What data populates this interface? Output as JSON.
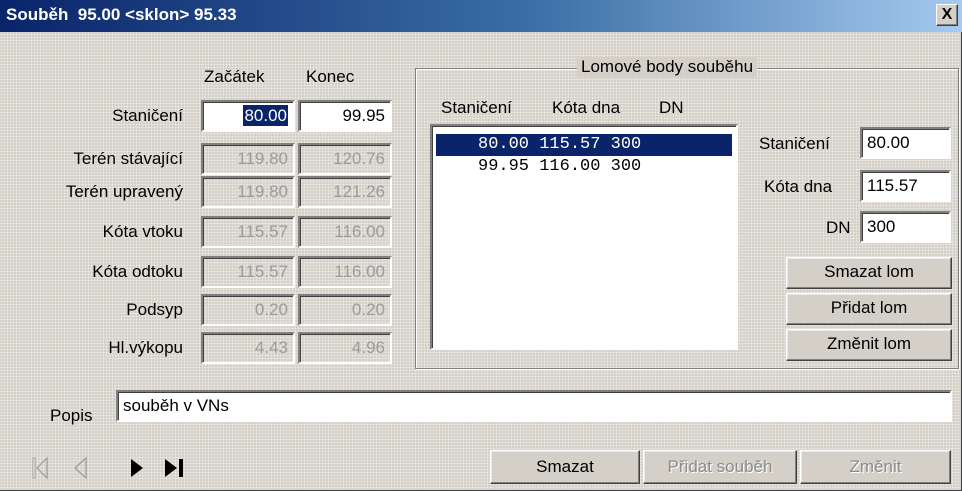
{
  "window": {
    "title": "Souběh  95.00 <sklon> 95.33",
    "close_label": "X"
  },
  "columns": {
    "start": "Začátek",
    "end": "Konec"
  },
  "rows": [
    {
      "label": "Staničení",
      "start": "80.00",
      "end": "99.95"
    },
    {
      "label": "Terén stávající",
      "start": "119.80",
      "end": "120.76"
    },
    {
      "label": "Terén upravený",
      "start": "119.80",
      "end": "121.26"
    },
    {
      "label": "Kóta vtoku",
      "start": "115.57",
      "end": "116.00"
    },
    {
      "label": "Kóta odtoku",
      "start": "115.57",
      "end": "116.00"
    },
    {
      "label": "Podsyp",
      "start": "0.20",
      "end": "0.20"
    },
    {
      "label": "Hl.výkopu",
      "start": "4.43",
      "end": "4.96"
    }
  ],
  "breakpoints": {
    "group_title": "Lomové body souběhu",
    "headers": [
      "Staničení",
      "Kóta dna",
      "DN"
    ],
    "items": [
      "80.00 115.57 300",
      "99.95 116.00 300"
    ],
    "selected_index": 0,
    "detail": {
      "station_label": "Staničení",
      "station_value": "80.00",
      "bottom_label": "Kóta dna",
      "bottom_value": "115.57",
      "dn_label": "DN",
      "dn_value": "300"
    },
    "buttons": {
      "delete": "Smazat lom",
      "add": "Přidat lom",
      "change": "Změnit lom"
    }
  },
  "description": {
    "label": "Popis",
    "value": "souběh v VNs"
  },
  "footer": {
    "delete": "Smazat",
    "add": "Přidat souběh",
    "change": "Změnit"
  }
}
